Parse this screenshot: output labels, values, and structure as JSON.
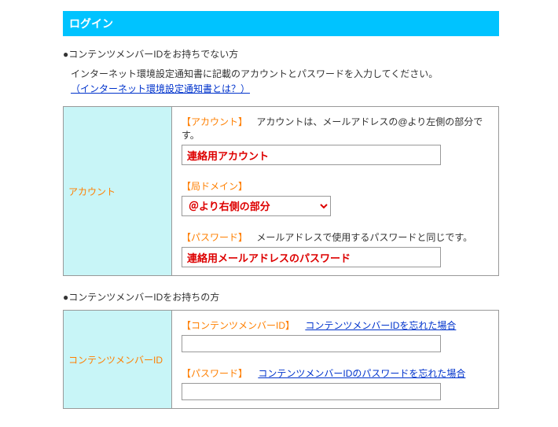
{
  "header": {
    "title": "ログイン"
  },
  "section1": {
    "lead": "●コンテンツメンバーIDをお持ちでない方",
    "intro": "インターネット環境設定通知書に記載のアカウントとパスワードを入力してください。",
    "intro_link": "（インターネット環境設定通知書とは？）",
    "row_label": "アカウント",
    "account": {
      "label": "【アカウント】",
      "note": "アカウントは、メールアドレスの@より左側の部分です。",
      "value": "連絡用アカウント"
    },
    "domain": {
      "label": "【局ドメイン】",
      "value": "＠より右側の部分"
    },
    "password": {
      "label": "【パスワード】",
      "note": "メールアドレスで使用するパスワードと同じです。",
      "value": "連絡用メールアドレスのパスワード"
    }
  },
  "section2": {
    "lead": "●コンテンツメンバーIDをお持ちの方",
    "row_label": "コンテンツメンバーID",
    "id": {
      "label": "【コンテンツメンバーID】",
      "link": "コンテンツメンバーIDを忘れた場合"
    },
    "password": {
      "label": "【パスワード】",
      "link": "コンテンツメンバーIDのパスワードを忘れた場合"
    }
  }
}
